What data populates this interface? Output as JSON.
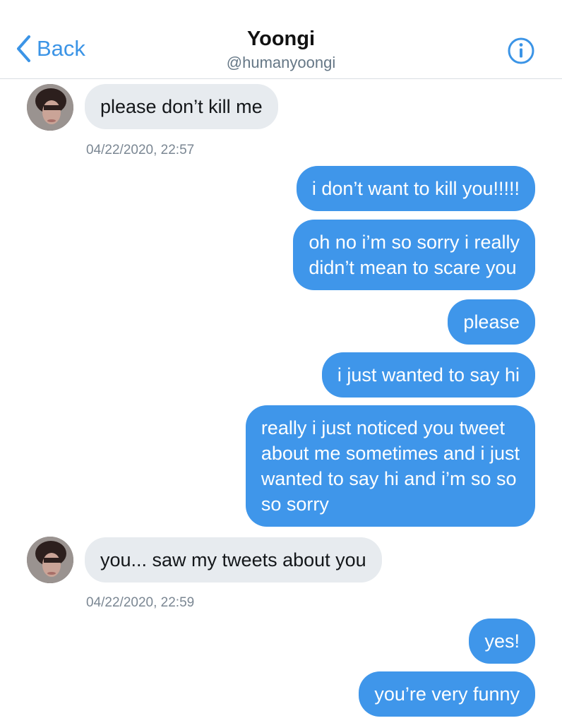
{
  "header": {
    "back_label": "Back",
    "title": "Yoongi",
    "handle": "@humanyoongi",
    "back_icon": "chevron-left-icon",
    "info_icon": "info-icon"
  },
  "colors": {
    "accent": "#3b94e6",
    "outgoing_bubble": "#3f96ea",
    "incoming_bubble": "#e7ebef"
  },
  "messages": [
    {
      "direction": "in",
      "text": "please don’t kill me"
    },
    {
      "direction": "out",
      "text": "i don’t want to kill you!!!!!"
    },
    {
      "direction": "out",
      "lines": [
        "oh no i’m so sorry i really",
        "didn’t mean to scare you"
      ]
    },
    {
      "direction": "out",
      "text": "please"
    },
    {
      "direction": "out",
      "text": "i just wanted to say hi"
    },
    {
      "direction": "out",
      "lines": [
        "really i just noticed you tweet",
        "about me sometimes and i just",
        "wanted to say hi and i’m so so",
        "so sorry"
      ]
    },
    {
      "direction": "in",
      "text": "you... saw my tweets about you"
    },
    {
      "direction": "out",
      "text": "yes!"
    },
    {
      "direction": "out",
      "text": "you’re very funny"
    }
  ],
  "timestamps": [
    "04/22/2020, 22:57",
    "04/22/2020, 22:59"
  ]
}
